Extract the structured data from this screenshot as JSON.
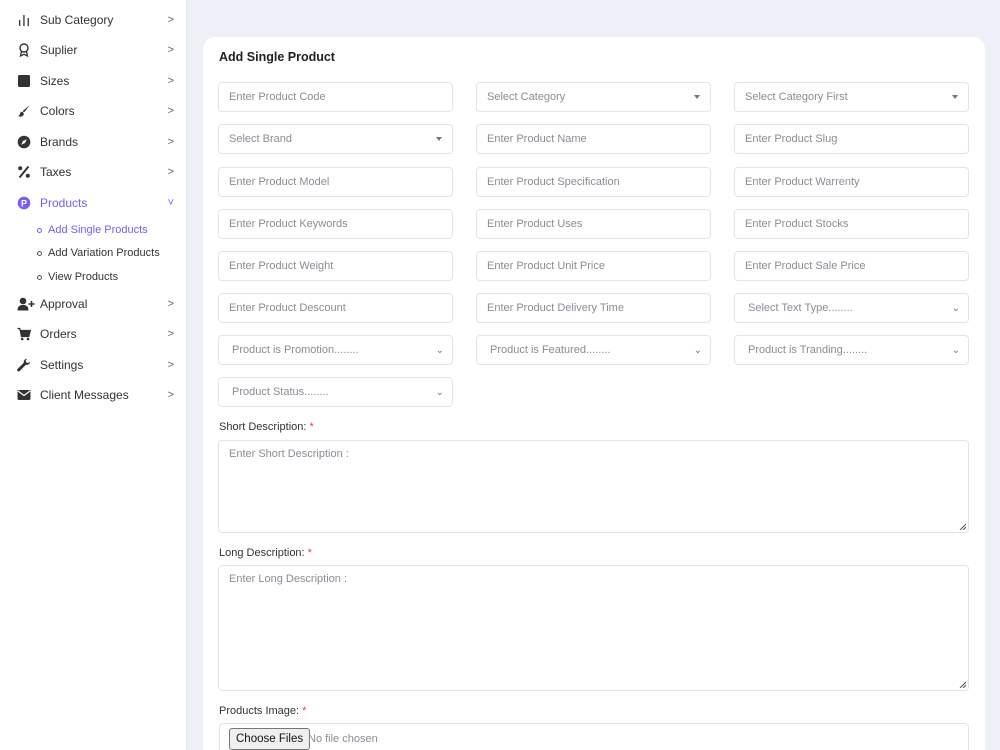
{
  "sidebar": {
    "items": [
      {
        "label": "Sub Category",
        "icon": "bar-chart-icon",
        "chevron": ">"
      },
      {
        "label": "Suplier",
        "icon": "award-icon",
        "chevron": ">"
      },
      {
        "label": "Sizes",
        "icon": "square-icon",
        "chevron": ">"
      },
      {
        "label": "Colors",
        "icon": "brush-icon",
        "chevron": ">"
      },
      {
        "label": "Brands",
        "icon": "compass-icon",
        "chevron": ">"
      },
      {
        "label": "Taxes",
        "icon": "percent-icon",
        "chevron": ">"
      },
      {
        "label": "Products",
        "icon": "product-p-icon",
        "chevron": "˅"
      },
      {
        "label": "Approval",
        "icon": "user-plus-icon",
        "chevron": ">"
      },
      {
        "label": "Orders",
        "icon": "cart-icon",
        "chevron": ">"
      },
      {
        "label": "Settings",
        "icon": "wrench-icon",
        "chevron": ">"
      },
      {
        "label": "Client Messages",
        "icon": "envelope-icon",
        "chevron": ">"
      }
    ],
    "products_sub": [
      {
        "label": "Add Single Products"
      },
      {
        "label": "Add Variation Products"
      },
      {
        "label": "View Products"
      }
    ]
  },
  "form": {
    "title": "Add Single Product",
    "fields": [
      {
        "placeholder": "Enter Product Code"
      },
      {
        "placeholder": "Select Category"
      },
      {
        "placeholder": "Select Category First"
      },
      {
        "placeholder": "Select Brand"
      },
      {
        "placeholder": "Enter Product Name"
      },
      {
        "placeholder": "Enter Product Slug"
      },
      {
        "placeholder": "Enter Product Model"
      },
      {
        "placeholder": "Enter Product Specification"
      },
      {
        "placeholder": "Enter Product Warrenty"
      },
      {
        "placeholder": "Enter Product Keywords"
      },
      {
        "placeholder": "Enter Product Uses"
      },
      {
        "placeholder": "Enter Product Stocks"
      },
      {
        "placeholder": "Enter Product Weight"
      },
      {
        "placeholder": "Enter Product Unit Price"
      },
      {
        "placeholder": "Enter Product Sale Price"
      },
      {
        "placeholder": "Enter Product Descount"
      },
      {
        "placeholder": "Enter Product Delivery Time"
      },
      {
        "placeholder": "Select Text Type........"
      },
      {
        "placeholder": "Product is Promotion........"
      },
      {
        "placeholder": "Product is Featured........"
      },
      {
        "placeholder": "Product is Tranding........"
      },
      {
        "placeholder": "Product Status........"
      }
    ],
    "short_description": {
      "label": "Short Description:",
      "required": "*",
      "placeholder": "Enter Short Description :"
    },
    "long_description": {
      "label": "Long Description:",
      "required": "*",
      "placeholder": "Enter Long Description :"
    },
    "image": {
      "label": "Products Image:",
      "required": "*",
      "button": "Choose Files",
      "status": "No file chosen"
    }
  },
  "colors": {
    "accent": "#7c5cf0",
    "background": "#eef0f8",
    "required": "#e04444"
  }
}
